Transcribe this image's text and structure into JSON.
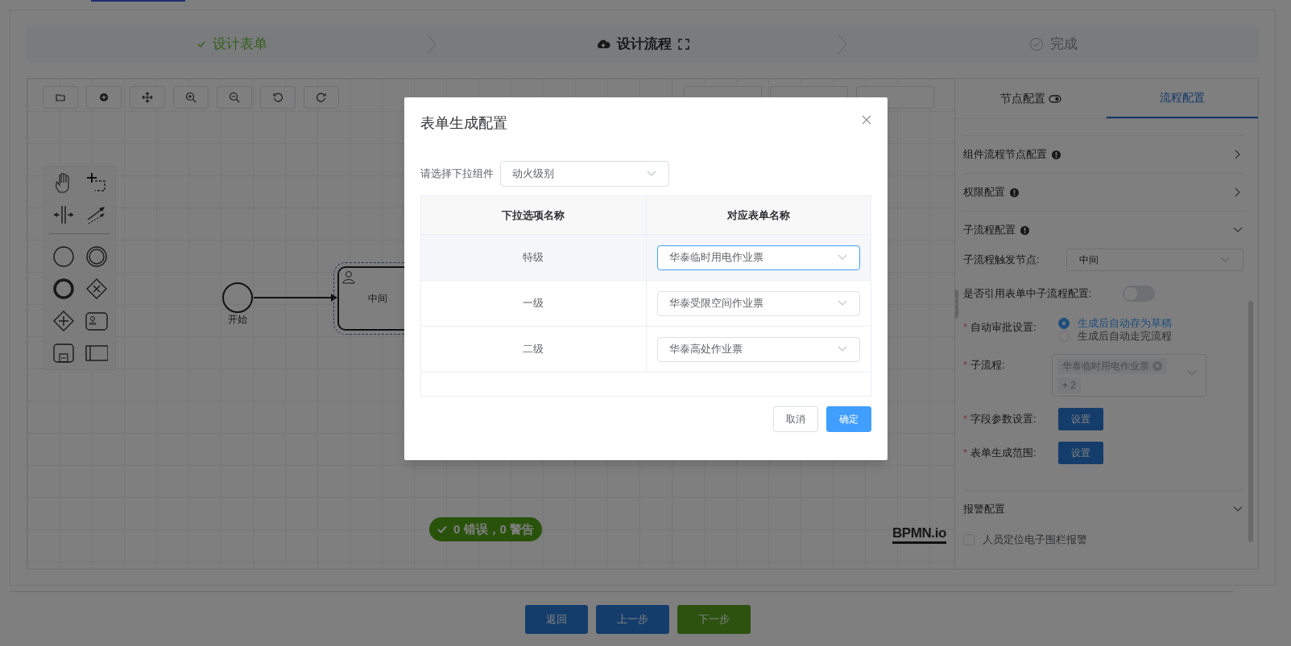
{
  "steps": [
    {
      "label": "设计表单",
      "completed": true,
      "selected": false
    },
    {
      "label": "设计流程",
      "completed": false,
      "selected": true
    },
    {
      "label": "完成",
      "completed": false,
      "selected": false
    }
  ],
  "diagram": {
    "start_event": {
      "label": "开始"
    },
    "task": {
      "label": "中间",
      "selected": true
    },
    "validation": "0 错误，0 警告",
    "logo": "BPMN.io"
  },
  "panel": {
    "tabs": [
      {
        "label": "节点配置",
        "selected": false
      },
      {
        "label": "流程配置",
        "selected": true
      }
    ],
    "sections": [
      {
        "title": "组件流程节点配置",
        "warning": true,
        "expanded": false
      },
      {
        "title": "权限配置",
        "warning": true,
        "expanded": false
      },
      {
        "title": "子流程配置",
        "warning": true,
        "expanded": true,
        "fields": [
          {
            "kind": "select",
            "label": "子流程触发节点:",
            "value": "中间"
          },
          {
            "kind": "switch",
            "label": "是否引用表单中子流程配置:",
            "on": false
          },
          {
            "kind": "radio",
            "label": "自动审批设置:",
            "required_mark": "*",
            "options": [
              {
                "label": "生成后自动存为草稿",
                "selected": true
              },
              {
                "label": "生成后自动走完流程",
                "selected": false
              }
            ]
          },
          {
            "kind": "multiselect",
            "label": "子流程:",
            "required_mark": "*",
            "tags": [
              "华泰临时用电作业票",
              "+ 2"
            ]
          },
          {
            "kind": "button",
            "label": "字段参数设置:",
            "required_mark": "*",
            "button": "设置"
          },
          {
            "kind": "button",
            "label": "表单生成范围:",
            "required_mark": "*",
            "button": "设置"
          }
        ]
      },
      {
        "title": "报警配置",
        "warning": false,
        "expanded": true,
        "fields": [
          {
            "kind": "checkbox",
            "label": "人员定位电子围栏报警",
            "checked": false
          }
        ]
      }
    ]
  },
  "footer": {
    "buttons": [
      {
        "label": "返回",
        "kind": "primary"
      },
      {
        "label": "上一步",
        "kind": "primary"
      },
      {
        "label": "下一步",
        "kind": "success"
      }
    ]
  },
  "dialog": {
    "title": "表单生成配置",
    "select_label": "请选择下拉组件",
    "select_value": "动火级别",
    "columns": [
      "下拉选项名称",
      "对应表单名称"
    ],
    "rows": [
      {
        "option": "特级",
        "form": "华泰临时用电作业票",
        "selected": true
      },
      {
        "option": "一级",
        "form": "华泰受限空间作业票",
        "selected": false
      },
      {
        "option": "二级",
        "form": "华泰高处作业票",
        "selected": false
      }
    ],
    "buttons": [
      {
        "label": "取消",
        "kind": "default"
      },
      {
        "label": "确定",
        "kind": "primary"
      }
    ]
  }
}
